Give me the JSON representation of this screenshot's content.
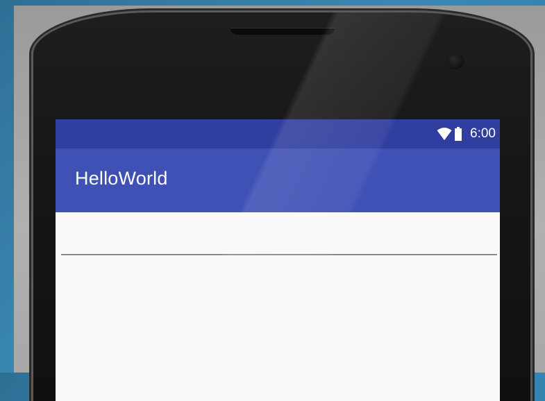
{
  "status_bar": {
    "time": "6:00",
    "icons": [
      "wifi-icon",
      "battery-icon"
    ]
  },
  "app_bar": {
    "title": "HelloWorld"
  },
  "edit_text": {
    "value": ""
  },
  "colors": {
    "status_bar": "#303f9f",
    "app_bar": "#3f51b5",
    "content_background": "#fafafa"
  }
}
